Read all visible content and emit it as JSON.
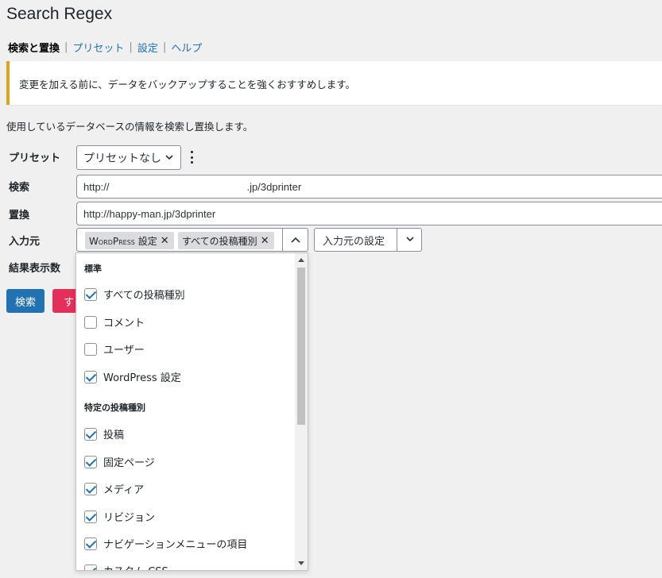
{
  "title": "Search Regex",
  "subnav": {
    "current": "検索と置換",
    "links": [
      "プリセット",
      "設定",
      "ヘルプ"
    ]
  },
  "notice": "変更を加える前に、データをバックアップすることを強くおすすめします。",
  "intro": "使用しているデータベースの情報を検索し置換します。",
  "form": {
    "preset_label": "プリセット",
    "preset_value": "プリセットなし",
    "search_label": "検索",
    "search_value_prefix": "http://",
    "search_value_suffix": ".jp/3dprinter",
    "replace_label": "置換",
    "replace_value": "http://happy-man.jp/3dprinter",
    "source_label": "入力元",
    "source_tokens": [
      "WordPress 設定",
      "すべての投稿種別"
    ],
    "source_settings": "入力元の設定",
    "results_label": "結果表示数"
  },
  "buttons": {
    "search": "検索",
    "replace_all_partial": "す"
  },
  "dropdown": {
    "groups": [
      {
        "title": "標準",
        "options": [
          {
            "label": "すべての投稿種別",
            "checked": true
          },
          {
            "label": "コメント",
            "checked": false
          },
          {
            "label": "ユーザー",
            "checked": false
          },
          {
            "label": "WordPress 設定",
            "checked": true
          }
        ]
      },
      {
        "title": "特定の投稿種別",
        "options": [
          {
            "label": "投稿",
            "checked": true
          },
          {
            "label": "固定ページ",
            "checked": true
          },
          {
            "label": "メディア",
            "checked": true
          },
          {
            "label": "リビジョン",
            "checked": true
          },
          {
            "label": "ナビゲーションメニューの項目",
            "checked": true
          },
          {
            "label": "カスタム CSS",
            "checked": true
          }
        ]
      }
    ]
  },
  "colors": {
    "link": "#2271b1",
    "primary": "#2271b1",
    "danger": "#e2305a",
    "notice_border": "#dba617"
  }
}
